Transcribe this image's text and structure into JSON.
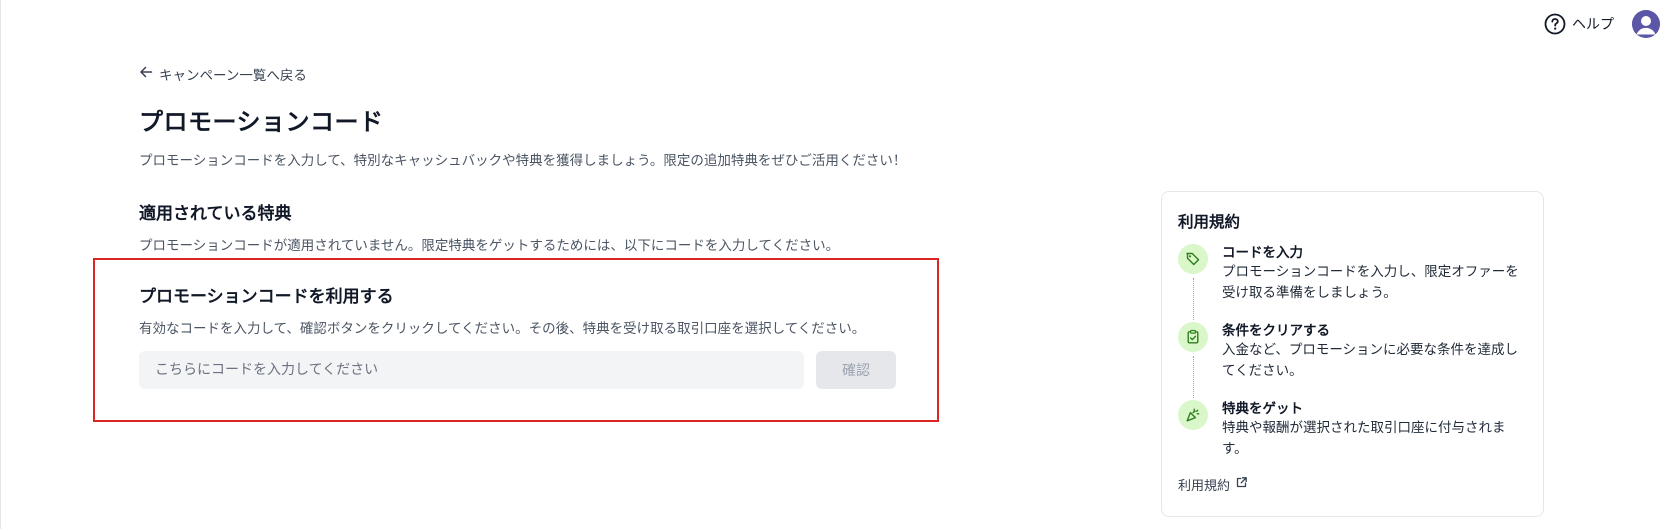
{
  "header": {
    "help_label": "ヘルプ",
    "help_icon": "question-circle-icon",
    "avatar_icon": "user-avatar-icon"
  },
  "main": {
    "back_link": "キャンペーン一覧へ戻る",
    "title": "プロモーションコード",
    "description": "プロモーションコードを入力して、特別なキャッシュバックや特典を獲得しましょう。限定の追加特典をぜひご活用ください！",
    "applied_section": {
      "title": "適用されている特典",
      "description": "プロモーションコードが適用されていません。限定特典をゲットするためには、以下にコードを入力してください。"
    },
    "promo_section": {
      "title": "プロモーションコードを利用する",
      "description": "有効なコードを入力して、確認ボタンをクリックしてください。その後、特典を受け取る取引口座を選択してください。",
      "input_placeholder": "こちらにコードを入力してください",
      "input_value": "",
      "confirm_label": "確認"
    }
  },
  "terms": {
    "title": "利用規約",
    "steps": [
      {
        "icon": "tag-icon",
        "title": "コードを入力",
        "description": "プロモーションコードを入力し、限定オファーを受け取る準備をしましょう。"
      },
      {
        "icon": "clipboard-check-icon",
        "title": "条件をクリアする",
        "description": "入金など、プロモーションに必要な条件を達成してください。"
      },
      {
        "icon": "party-popper-icon",
        "title": "特典をゲット",
        "description": "特典や報酬が選択された取引口座に付与されます。"
      }
    ],
    "link_label": "利用規約",
    "link_icon": "external-link-icon"
  },
  "colors": {
    "highlight_border": "#dc2626",
    "step_icon_bg": "#d9f7c9",
    "step_icon_fg": "#2f7d1f",
    "avatar_bg": "#5b57a6"
  }
}
